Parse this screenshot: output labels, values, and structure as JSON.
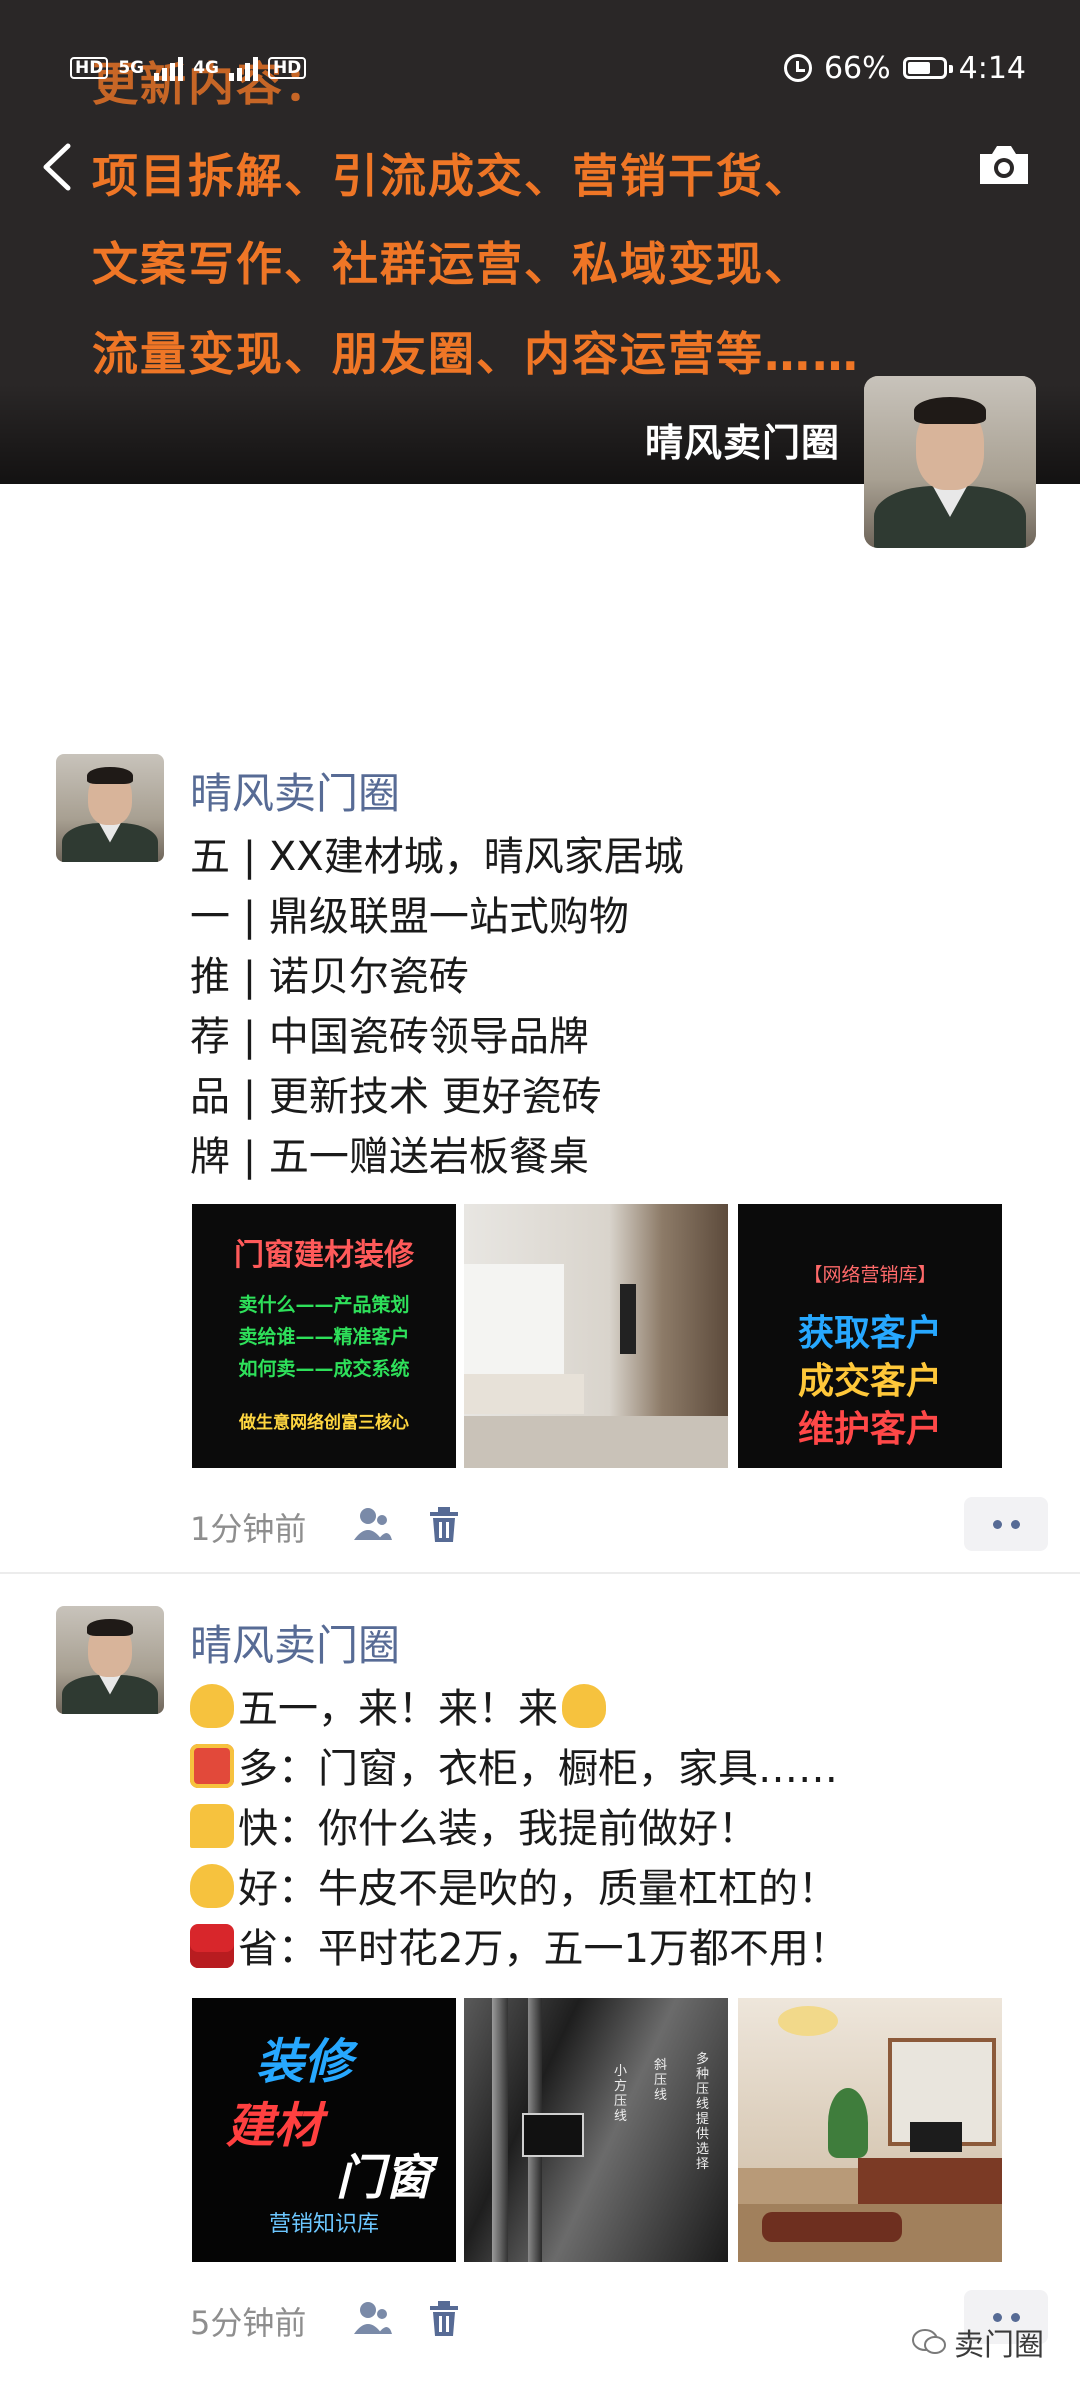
{
  "status_bar": {
    "hd1": "HD",
    "hd2": "HD",
    "net1": "5G",
    "net2": "4G",
    "battery": "66%",
    "battery_level": 0.66,
    "time": "4:14"
  },
  "cover": {
    "title": "更新内容：",
    "lines": [
      "项目拆解、引流成交、营销干货、",
      "文案写作、社群运营、私域变现、",
      "流量变现、朋友圈、内容运营等……"
    ],
    "accent_color": "#ef7626"
  },
  "profile": {
    "name": "晴风卖门圈"
  },
  "posts": [
    {
      "author": "晴风卖门圈",
      "lines": [
        "五 | XX建材城，晴风家居城",
        "一 | 鼎级联盟一站式购物",
        "推 | 诺贝尔瓷砖",
        "荐 | 中国瓷砖领导品牌",
        "品 | 更新技术 更好瓷砖",
        "牌 |  五一赠送岩板餐桌"
      ],
      "images": [
        {
          "title": "门窗建材装修",
          "lines": [
            "卖什么——产品策划",
            "卖给谁——精准客户",
            "如何卖——成交系统"
          ],
          "footer": "做生意网络创富三核心"
        },
        {
          "kind": "interior-photo"
        },
        {
          "title": "【网络营销库】",
          "lines": [
            "获取客户",
            "成交客户",
            "维护客户"
          ]
        }
      ],
      "time": "1分钟前"
    },
    {
      "author": "晴风卖门圈",
      "lines": [
        "五一，来！来！来",
        "多：门窗，衣柜，橱柜，家具……",
        "快：你什么装，我提前做好！",
        "好：牛皮不是吹的，质量杠杠的！",
        "省：平时花2万，五一1万都不用！"
      ],
      "images": [
        {
          "lines": [
            "装修",
            "建材",
            "门窗"
          ],
          "footer": "营销知识库"
        },
        {
          "lines": [
            "多种压线提供选择",
            "斜压线",
            "小方压线"
          ]
        },
        {
          "kind": "living-room-photo"
        }
      ],
      "time": "5分钟前"
    }
  ],
  "watermark": "卖门圈"
}
